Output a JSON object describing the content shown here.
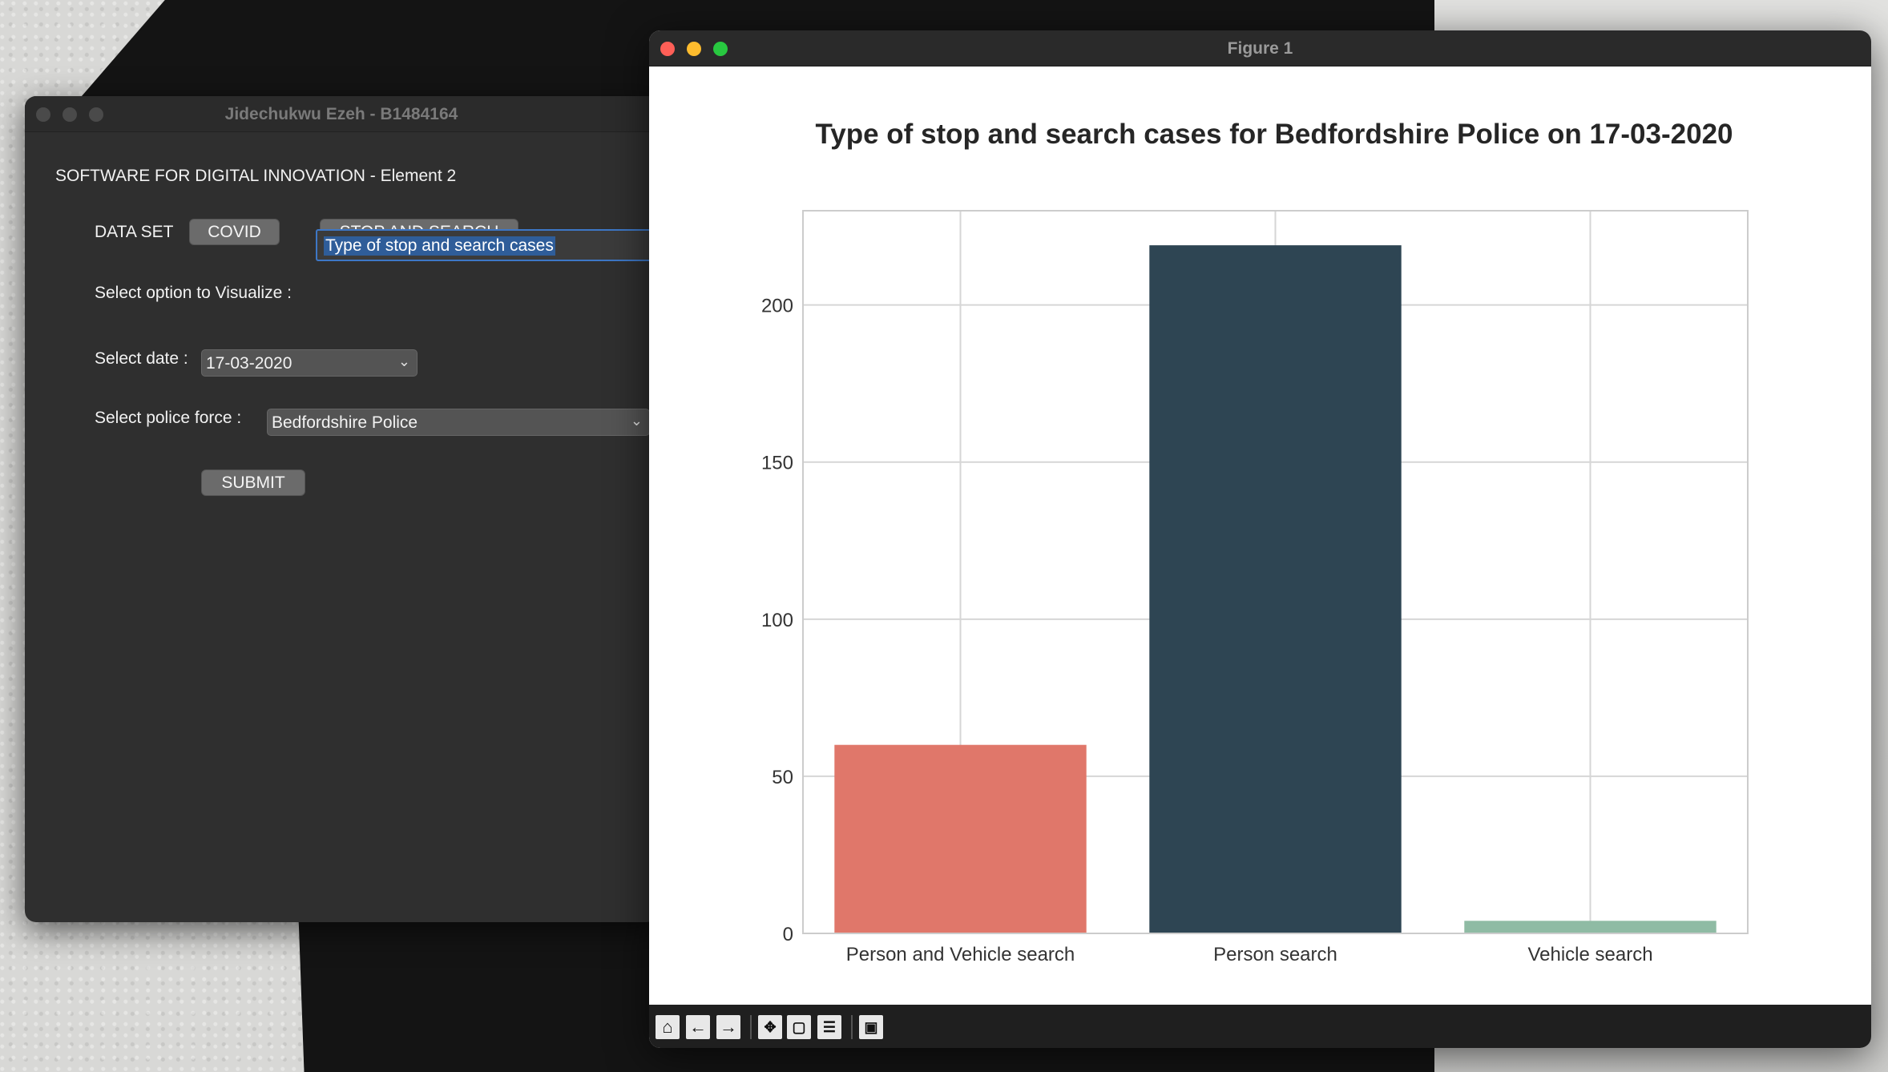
{
  "tk_window": {
    "title": "Jidechukwu Ezeh - B1484164",
    "heading": "SOFTWARE FOR DIGITAL INNOVATION - Element 2",
    "dataset_label": "DATA SET",
    "covid_button": "COVID",
    "stop_search_button": "STOP AND SEARCH",
    "visualize_label": "Select option to Visualize :",
    "visualize_value": "Type of stop and search cases",
    "date_label": "Select date :",
    "date_value": "17-03-2020",
    "force_label": "Select police force :",
    "force_value": "Bedfordshire Police",
    "submit_button": "SUBMIT"
  },
  "figure_window": {
    "title": "Figure 1",
    "toolbar_icons": [
      "home-icon",
      "back-arrow-icon",
      "forward-arrow-icon",
      "pan-icon",
      "zoom-icon",
      "configure-subplots-icon",
      "save-icon"
    ]
  },
  "chart_data": {
    "type": "bar",
    "title": "Type of stop and search cases for Bedfordshire Police on 17-03-2020",
    "xlabel": "",
    "ylabel": "",
    "categories": [
      "Person and Vehicle search",
      "Person search",
      "Vehicle search"
    ],
    "values": [
      60,
      219,
      4
    ],
    "colors": [
      "#e0776a",
      "#2e4553",
      "#8fbba4"
    ],
    "ylim": [
      0,
      230
    ],
    "yticks": [
      0,
      50,
      100,
      150,
      200
    ],
    "grid": true
  }
}
